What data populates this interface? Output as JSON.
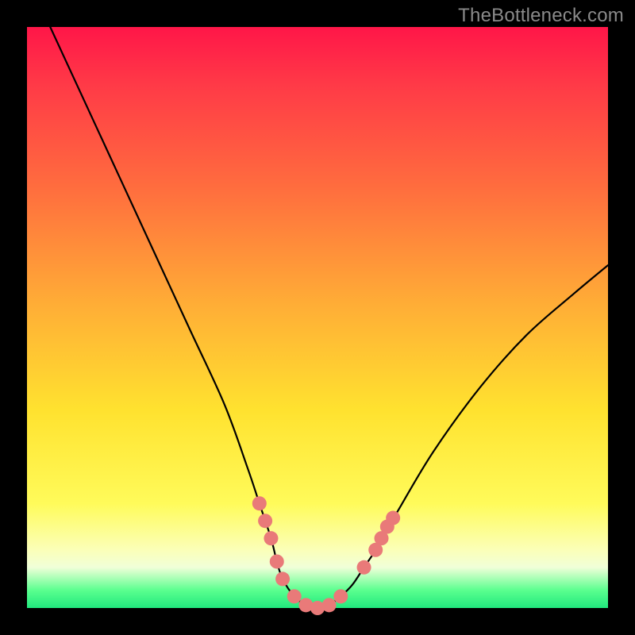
{
  "watermark": "TheBottleneck.com",
  "chart_data": {
    "type": "line",
    "title": "",
    "xlabel": "",
    "ylabel": "",
    "xlim": [
      0,
      100
    ],
    "ylim": [
      0,
      100
    ],
    "series": [
      {
        "name": "bottleneck-curve",
        "x": [
          4,
          10,
          16,
          22,
          28,
          34,
          38,
          40,
          42,
          43,
          44,
          46,
          48,
          50,
          52,
          54,
          56,
          58,
          60,
          64,
          70,
          78,
          86,
          94,
          100
        ],
        "y": [
          100,
          87,
          74,
          61,
          48,
          35,
          24,
          18,
          12,
          8,
          5,
          2,
          0.5,
          0,
          0.5,
          2,
          4,
          7,
          10,
          17,
          27,
          38,
          47,
          54,
          59
        ],
        "stroke": "#000000",
        "stroke_width": 2.2
      }
    ],
    "markers": {
      "name": "highlight-dots",
      "color": "#e97a79",
      "radius": 9,
      "points": [
        {
          "x": 40,
          "y": 18
        },
        {
          "x": 41,
          "y": 15
        },
        {
          "x": 42,
          "y": 12
        },
        {
          "x": 43,
          "y": 8
        },
        {
          "x": 44,
          "y": 5
        },
        {
          "x": 46,
          "y": 2
        },
        {
          "x": 48,
          "y": 0.5
        },
        {
          "x": 50,
          "y": 0
        },
        {
          "x": 52,
          "y": 0.5
        },
        {
          "x": 54,
          "y": 2
        },
        {
          "x": 58,
          "y": 7
        },
        {
          "x": 60,
          "y": 10
        },
        {
          "x": 61,
          "y": 12
        },
        {
          "x": 62,
          "y": 14
        },
        {
          "x": 63,
          "y": 15.5
        }
      ]
    }
  }
}
